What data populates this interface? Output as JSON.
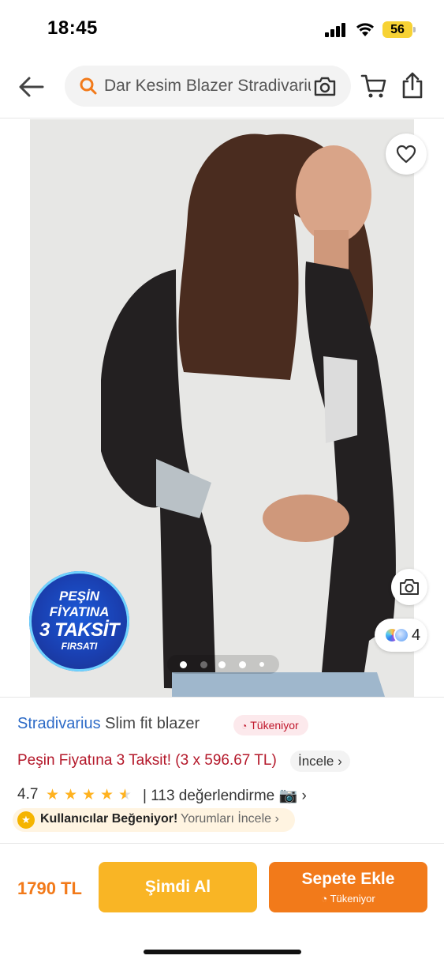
{
  "status_bar": {
    "time": "18:45",
    "battery": "56"
  },
  "header": {
    "search_text": "Dar Kesim Blazer Stradivarius"
  },
  "gallery": {
    "color_count": "4",
    "badge": {
      "line1": "PEŞİN",
      "line2": "FİYATINA",
      "line3": "3 TAKSİT",
      "line4": "FIRSATI"
    },
    "dots_total": 5,
    "dots_active": 1
  },
  "product": {
    "brand": "Stradivarius",
    "name": " Slim fit blazer",
    "stock_status": "Tükeniyor",
    "installment_text": "Peşin Fiyatına 3 Taksit! (3 x 596.67 TL)",
    "installment_link": "İncele ›",
    "rating": "4.7",
    "rating_stars": 4.5,
    "reviews_text": "| 113 değerlendirme 📷 ›",
    "likes_label": "Kullanıcılar Beğeniyor!",
    "likes_link": "Yorumları İncele ›"
  },
  "bottom_bar": {
    "price": "1790 TL",
    "buy_now": "Şimdi Al",
    "add_to_cart": "Sepete Ekle",
    "add_to_cart_sub": "Tükeniyor"
  },
  "colors": {
    "accent": "#f27a1a",
    "buy_now": "#f9b525",
    "brand_link": "#2d6bc7",
    "installment": "#b4182a",
    "star": "#ffb21f"
  }
}
